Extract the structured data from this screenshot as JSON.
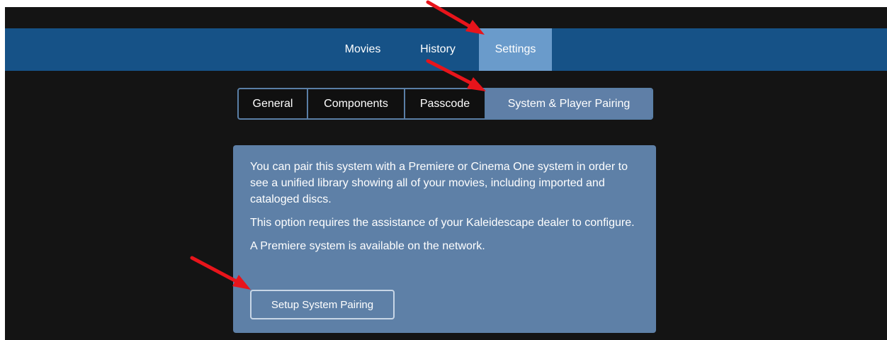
{
  "nav": {
    "tabs": [
      {
        "label": "Movies"
      },
      {
        "label": "History"
      },
      {
        "label": "Settings"
      }
    ],
    "active": "Settings"
  },
  "settings_tabs": {
    "tabs": [
      {
        "label": "General"
      },
      {
        "label": "Components"
      },
      {
        "label": "Passcode"
      },
      {
        "label": "System & Player Pairing"
      }
    ],
    "active": "System & Player Pairing"
  },
  "pairing_panel": {
    "paragraph_1": "You can pair this system with a Premiere or Cinema One system in order to see a unified library showing all of your movies, including imported and cataloged discs.",
    "paragraph_2": "This option requires the assistance of your Kaleidescape dealer to configure.",
    "paragraph_3": "A Premiere system is available on the network.",
    "button_label": "Setup System Pairing"
  },
  "colors": {
    "nav_background": "#165287",
    "nav_active": "#6a9bcb",
    "panel_background": "#5e80a7",
    "app_background": "#141414",
    "annotation_arrow": "#e8141b"
  }
}
